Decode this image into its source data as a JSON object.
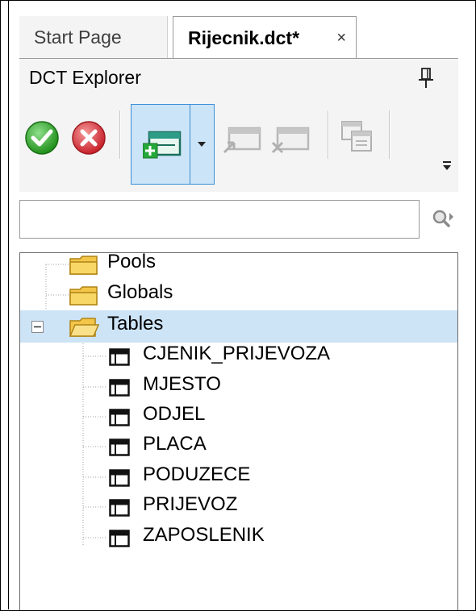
{
  "tabs": [
    {
      "label": "Start Page",
      "active": false
    },
    {
      "label": "Rijecnik.dct*",
      "active": true,
      "close_glyph": "×"
    }
  ],
  "panel": {
    "title": "DCT Explorer",
    "pin_icon": "pin-icon"
  },
  "toolbar": {
    "buttons": [
      {
        "name": "accept",
        "icon": "green-check-icon",
        "enabled": true
      },
      {
        "name": "cancel",
        "icon": "red-x-icon",
        "enabled": true
      },
      {
        "name": "add-table",
        "icon": "add-table-icon",
        "enabled": true,
        "pressed": true,
        "has_dropdown": true
      },
      {
        "name": "move-in",
        "icon": "import-icon",
        "enabled": false
      },
      {
        "name": "remove",
        "icon": "remove-icon",
        "enabled": false
      },
      {
        "name": "copy",
        "icon": "copy-icon",
        "enabled": false
      }
    ],
    "overflow_icon": "overflow-icon"
  },
  "search": {
    "value": "",
    "placeholder": "",
    "icon": "search-icon"
  },
  "tree": {
    "roots": [
      {
        "label": "Pools",
        "icon": "folder-closed-icon"
      },
      {
        "label": "Globals",
        "icon": "folder-closed-icon"
      },
      {
        "label": "Tables",
        "icon": "folder-open-icon",
        "expanded": true,
        "selected": true,
        "children": [
          {
            "label": "CJENIK_PRIJEVOZA",
            "icon": "table-icon"
          },
          {
            "label": "MJESTO",
            "icon": "table-icon"
          },
          {
            "label": "ODJEL",
            "icon": "table-icon"
          },
          {
            "label": "PLACA",
            "icon": "table-icon"
          },
          {
            "label": "PODUZECE",
            "icon": "table-icon"
          },
          {
            "label": "PRIJEVOZ",
            "icon": "table-icon"
          },
          {
            "label": "ZAPOSLENIK",
            "icon": "table-icon"
          }
        ]
      }
    ]
  },
  "colors": {
    "selection": "#cde3f6",
    "pressed_button": "#cce4f7",
    "folder": "#f3c64a"
  }
}
